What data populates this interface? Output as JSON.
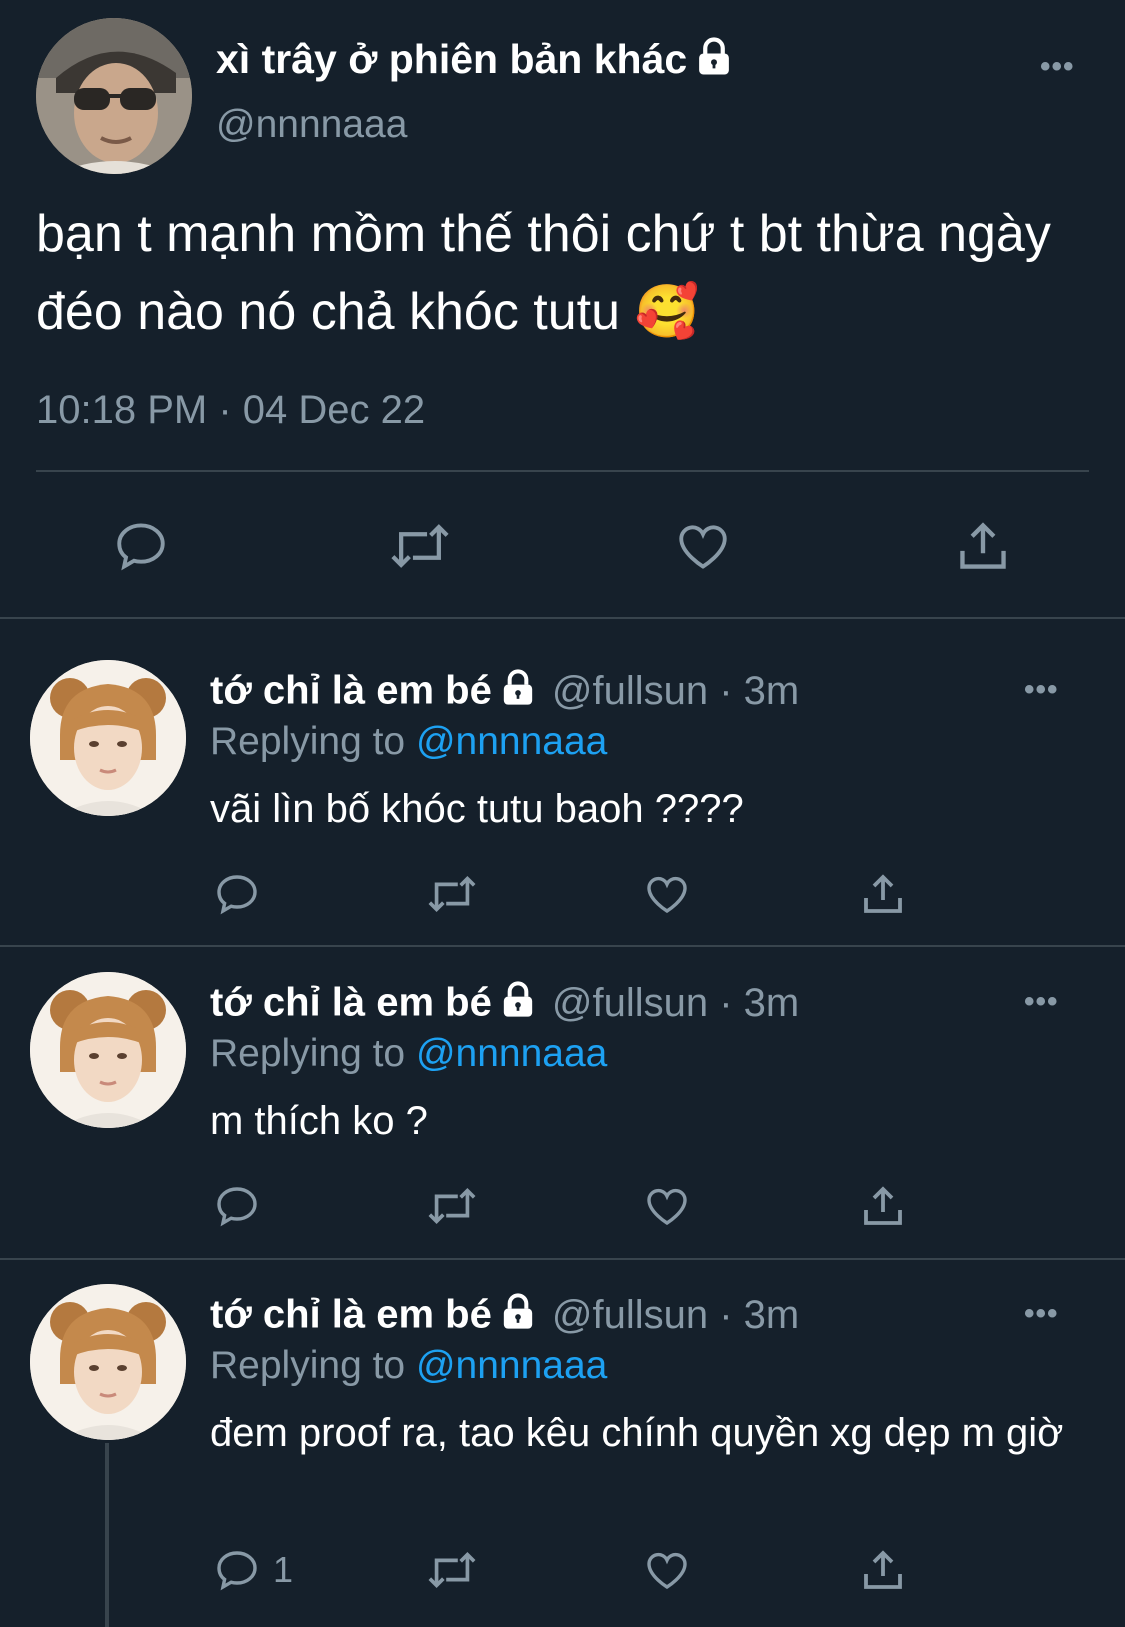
{
  "main_tweet": {
    "display_name": "xì trây ở phiên bản khác",
    "handle": "@nnnnaaa",
    "text": "bạn t mạnh mồm thế thôi chứ t bt thừa ngày đéo nào nó chả khóc tutu 🥰",
    "timestamp": "10:18 PM · 04 Dec 22",
    "more_label": "•••"
  },
  "replies": [
    {
      "display_name": "tớ chỉ là em bé",
      "handle_time": "@fullsun · 3m",
      "replying_prefix": "Replying to ",
      "replying_to": "@nnnnaaa",
      "text": "vãi lìn bố khóc tutu baoh ????",
      "more_label": "•••",
      "reply_count": ""
    },
    {
      "display_name": "tớ chỉ là em bé",
      "handle_time": "@fullsun · 3m",
      "replying_prefix": "Replying to ",
      "replying_to": "@nnnnaaa",
      "text": "m thích ko ?",
      "more_label": "•••",
      "reply_count": ""
    },
    {
      "display_name": "tớ chỉ là em bé",
      "handle_time": "@fullsun · 3m",
      "replying_prefix": "Replying to ",
      "replying_to": "@nnnnaaa",
      "text": "đem proof ra, tao kêu chính quyền xg dẹp m giờ",
      "more_label": "•••",
      "reply_count": "1"
    }
  ],
  "icons": [
    "reply-icon",
    "retweet-icon",
    "like-icon",
    "share-icon",
    "lock-icon",
    "more-icon"
  ],
  "colors": {
    "background": "#15202b",
    "secondary_text": "#8899a6",
    "link": "#1da1f2",
    "divider": "#38444d"
  }
}
